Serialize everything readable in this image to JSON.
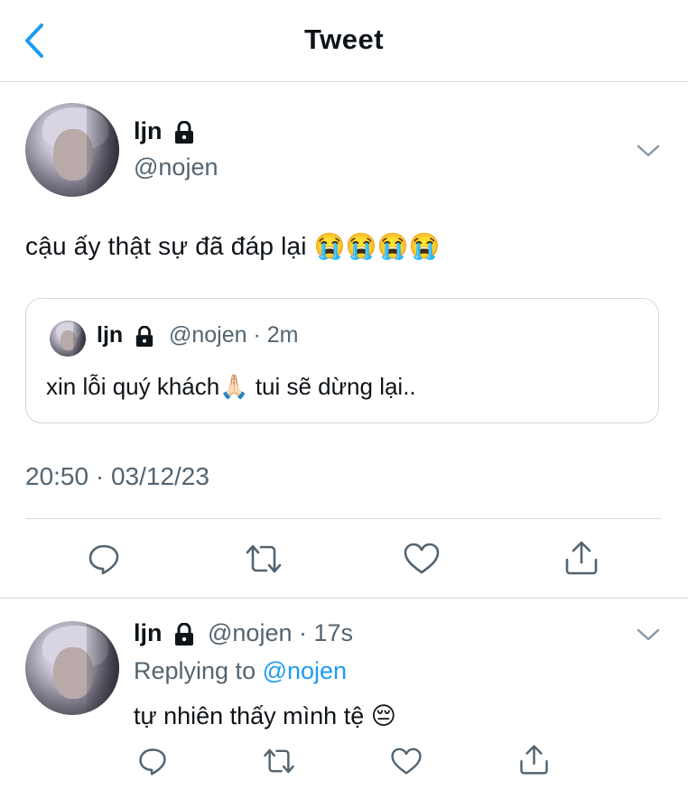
{
  "nav": {
    "title": "Tweet",
    "back_icon": "chevron-left-icon",
    "accent": "#1d9bf0"
  },
  "tweet": {
    "name": "ljn",
    "handle": "@nojen",
    "text": "cậu ấy thật sự đã đáp lại 😭😭😭😭",
    "quote": {
      "name": "ljn",
      "handle_time": "@nojen · 2m",
      "text": "xin lỗi quý khách🙏🏻 tui sẽ dừng lại.."
    },
    "timestamp": "20:50 · 03/12/23"
  },
  "reply": {
    "name": "ljn",
    "handle_time": "@nojen · 17s",
    "replying_prefix": "Replying to ",
    "replying_handle": "@nojen",
    "text": "tự nhiên thấy mình tệ 😔"
  },
  "actions": [
    "reply-icon",
    "retweet-icon",
    "like-icon",
    "share-icon"
  ]
}
